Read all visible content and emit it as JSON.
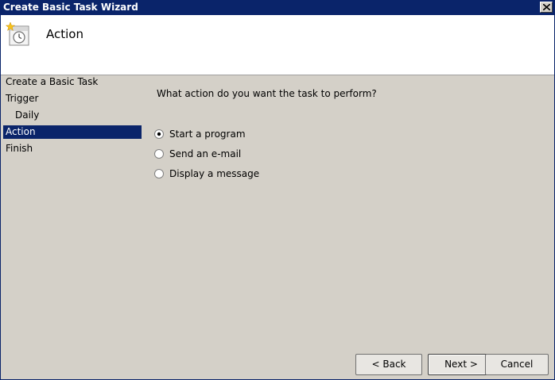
{
  "window": {
    "title": "Create Basic Task Wizard"
  },
  "header": {
    "title": "Action"
  },
  "nav": {
    "items": [
      {
        "label": "Create a Basic Task"
      },
      {
        "label": "Trigger"
      },
      {
        "label": "Daily"
      },
      {
        "label": "Action"
      },
      {
        "label": "Finish"
      }
    ],
    "selected": "Action"
  },
  "main": {
    "question": "What action do you want the task to perform?",
    "options": [
      {
        "label": "Start a program",
        "checked": true
      },
      {
        "label": "Send an e-mail",
        "checked": false
      },
      {
        "label": "Display a message",
        "checked": false
      }
    ]
  },
  "buttons": {
    "back": "< Back",
    "next": "Next >",
    "cancel": "Cancel"
  },
  "colors": {
    "titlebar": "#0a246a",
    "selection": "#0a246a",
    "dialog_bg": "#d4d0c8",
    "header_bg": "#ffffff"
  },
  "icons": {
    "close": "close-icon",
    "wizard": "scheduled-task-clock-icon"
  }
}
